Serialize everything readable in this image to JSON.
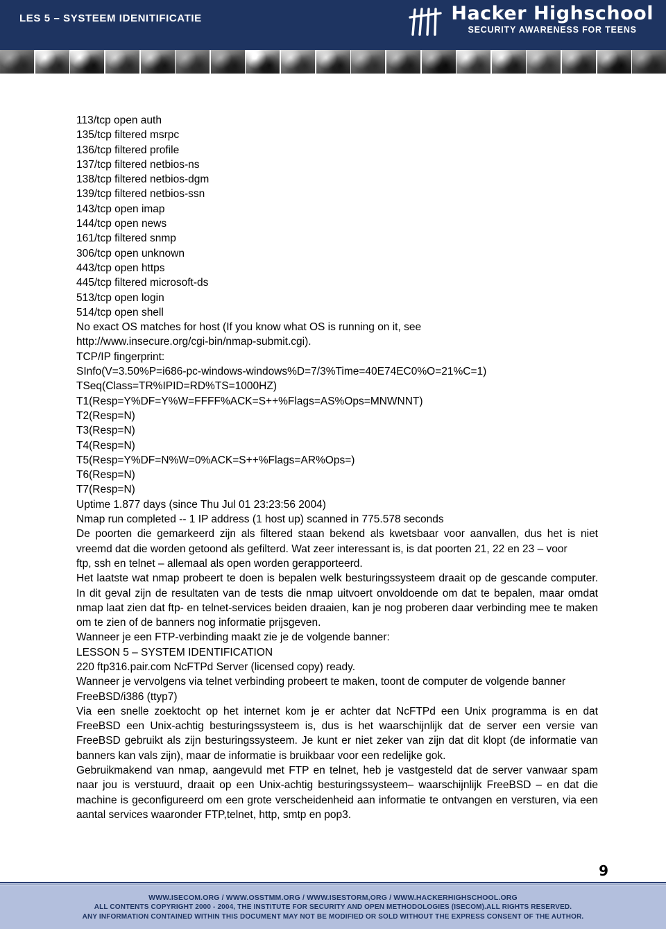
{
  "header": {
    "lesson_title": "LES 5 – SYSTEEM IDENITIFICATIE",
    "logo_name": "Hacker Highschool",
    "logo_tagline": "SECURITY AWARENESS FOR TEENS",
    "logo_icon": "tally-marks-icon",
    "band_color": "#1e3461"
  },
  "photo_strip": {
    "cell_count": 19
  },
  "scan_output": {
    "lines": [
      "113/tcp open auth",
      "135/tcp filtered msrpc",
      "136/tcp filtered profile",
      "137/tcp filtered netbios-ns",
      "138/tcp filtered netbios-dgm",
      "139/tcp filtered netbios-ssn",
      "143/tcp open imap",
      "144/tcp open news",
      "161/tcp filtered snmp",
      "306/tcp open unknown",
      "443/tcp open https",
      "445/tcp filtered microsoft-ds",
      "513/tcp open login",
      "514/tcp open shell",
      "No exact OS matches for host (If you know what OS is running on it, see",
      "http://www.insecure.org/cgi-bin/nmap-submit.cgi).",
      "TCP/IP fingerprint:",
      "SInfo(V=3.50%P=i686-pc-windows-windows%D=7/3%Time=40E74EC0%O=21%C=1)",
      "TSeq(Class=TR%IPID=RD%TS=1000HZ)",
      "T1(Resp=Y%DF=Y%W=FFFF%ACK=S++%Flags=AS%Ops=MNWNNT)",
      "T2(Resp=N)",
      "T3(Resp=N)",
      "T4(Resp=N)",
      "T5(Resp=Y%DF=N%W=0%ACK=S++%Flags=AR%Ops=)",
      "T6(Resp=N)",
      "T7(Resp=N)",
      "Uptime 1.877 days (since Thu Jul 01 23:23:56 2004)",
      "Nmap run completed -- 1 IP address (1 host up) scanned in 775.578 seconds"
    ]
  },
  "body": {
    "para_filtered": "De poorten die gemarkeerd zijn als filtered staan bekend als kwetsbaar voor aanvallen, dus het is niet vreemd dat die worden getoond als gefilterd. Wat zeer interessant is, is dat poorten 21, 22 en 23 – voor",
    "line_ftp_ssh_telnet": "ftp, ssh en telnet – allemaal als open worden gerapporteerd.",
    "para_nmap_os": "Het laatste wat nmap probeert te doen is bepalen welk besturingssysteem draait op de gescande computer. In dit geval zijn de resultaten van de tests die nmap uitvoert onvoldoende om dat te bepalen, maar omdat nmap laat zien dat ftp- en telnet-services beiden draaien, kan je nog proberen daar verbinding mee te maken om te zien of de banners nog informatie prijsgeven.",
    "line_ftp_banner_intro": "Wanneer je een FTP-verbinding maakt zie je de volgende banner:",
    "line_lesson_en": "LESSON 5 – SYSTEM IDENTIFICATION",
    "line_ftp_banner": "220 ftp316.pair.com NcFTPd Server (licensed copy) ready.",
    "para_telnet_intro": "Wanneer je vervolgens via telnet verbinding probeert te maken, toont de computer de volgende banner",
    "line_telnet_banner": "FreeBSD/i386 (ttyp7)",
    "para_research": "Via een snelle zoektocht op het internet kom je er achter dat NcFTPd een Unix programma is en dat FreeBSD een Unix-achtig besturingssysteem is, dus is het waarschijnlijk dat de server een versie van FreeBSD gebruikt als zijn besturingssysteem. Je kunt er niet zeker van zijn dat dit klopt (de informatie van banners kan vals zijn), maar de informatie is bruikbaar voor een redelijke gok.",
    "para_conclusion": "Gebruikmakend van nmap, aangevuld met FTP en telnet, heb je vastgesteld dat de server vanwaar spam naar jou is verstuurd, draait op een Unix-achtig besturingssysteem– waarschijnlijk FreeBSD – en dat die machine is geconfigureerd om een grote verscheidenheid aan informatie te ontvangen en versturen, via een aantal services waaronder FTP,telnet, http, smtp en pop3."
  },
  "footer": {
    "page_number": "9",
    "urls_line": "WWW.ISECOM.ORG / WWW.OSSTMM.ORG / WWW.ISESTORM,ORG / WWW.HACKERHIGHSCHOOL.ORG",
    "copyright_line": "ALL CONTENTS COPYRIGHT 2000 - 2004, THE INSTITUTE FOR SECURITY AND OPEN METHODOLOGIES (ISECOM).ALL RIGHTS RESERVED.",
    "notice_line": "ANY INFORMATION CONTAINED WITHIN THIS DOCUMENT MAY NOT BE MODIFIED OR SOLD WITHOUT THE EXPRESS CONSENT OF THE AUTHOR.",
    "band_color": "#b3bfdd",
    "text_color": "#1e3461"
  }
}
